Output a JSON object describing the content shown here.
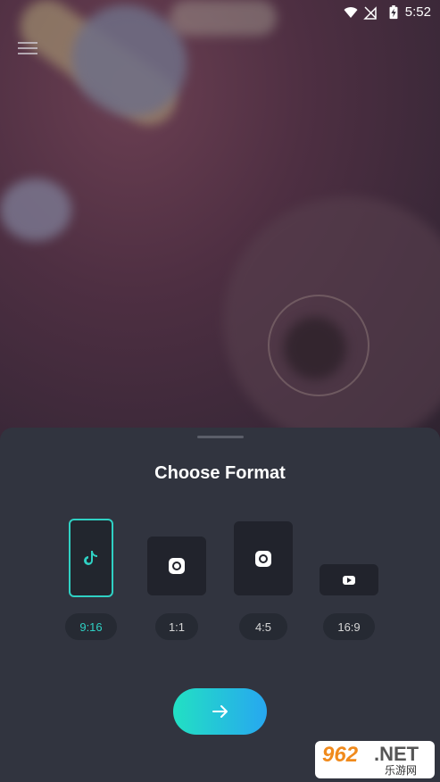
{
  "status": {
    "time": "5:52",
    "wifi_icon": "wifi-icon",
    "signal_icon": "no-signal-icon",
    "battery_icon": "battery-charging-icon"
  },
  "menu": {
    "icon": "hamburger-menu-icon"
  },
  "sheet": {
    "title": "Choose Format",
    "formats": [
      {
        "ratio": "9:16",
        "icon": "tiktok-icon",
        "selected": true
      },
      {
        "ratio": "1:1",
        "icon": "instagram-icon",
        "selected": false
      },
      {
        "ratio": "4:5",
        "icon": "instagram-icon",
        "selected": false
      },
      {
        "ratio": "16:9",
        "icon": "youtube-icon",
        "selected": false
      }
    ],
    "next_icon": "arrow-right-icon",
    "accent_color": "#2fd1c4"
  },
  "watermark": {
    "brand": "962",
    "suffix": ".NET",
    "subtitle": "乐游网"
  }
}
